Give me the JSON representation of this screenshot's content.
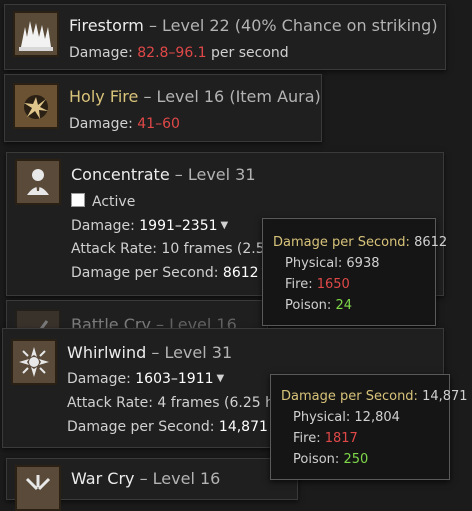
{
  "skills": [
    {
      "name": "Firestorm",
      "level": "– Level 22 (40% Chance on striking)",
      "damage_label": "Damage: ",
      "damage_value": "82.8–96.1",
      "damage_suffix": " per second"
    },
    {
      "name": "Holy Fire",
      "level": "– Level 16 (Item Aura)",
      "damage_label": "Damage: ",
      "damage_value": "41–60"
    },
    {
      "name": "Concentrate",
      "level": "– Level 31",
      "active_label": "Active",
      "damage_label": "Damage: ",
      "damage_value": "1991–2351",
      "attack_rate": "Attack Rate: 10 frames (2.5 hi",
      "dps_label": "Damage per Second: ",
      "dps_value": "8612"
    },
    {
      "name": "Battle Cry",
      "level": "– Level 16"
    },
    {
      "name": "Whirlwind",
      "level": "– Level 31",
      "damage_label": "Damage: ",
      "damage_value": "1603–1911",
      "attack_rate": "Attack Rate: 4 frames (6.25 hits",
      "dps_label": "Damage per Second: ",
      "dps_value": "14,871"
    },
    {
      "name": "War Cry",
      "level": "– Level 16"
    }
  ],
  "tooltips": [
    {
      "dps_label": "Damage per Second:",
      "dps_value": "8612",
      "physical_label": "Physical:",
      "physical_value": "6938",
      "fire_label": "Fire:",
      "fire_value": "1650",
      "poison_label": "Poison:",
      "poison_value": "24"
    },
    {
      "dps_label": "Damage per Second:",
      "dps_value": "14,871",
      "physical_label": "Physical:",
      "physical_value": "12,804",
      "fire_label": "Fire:",
      "fire_value": "1817",
      "poison_label": "Poison:",
      "poison_value": "250"
    }
  ],
  "colors": {
    "background": "#1b1b1b",
    "damage_red": "#e04848",
    "gold_title": "#d8c37a",
    "poison_green": "#7ed84a"
  },
  "icons": [
    "firestorm-icon",
    "holy-fire-icon",
    "concentrate-icon",
    "battle-cry-icon",
    "whirlwind-icon",
    "war-cry-icon",
    "caret-down-icon"
  ]
}
